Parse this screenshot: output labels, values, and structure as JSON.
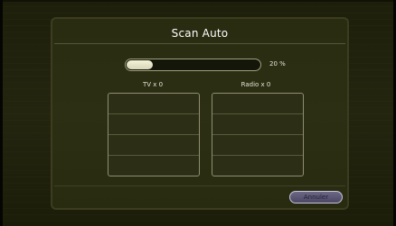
{
  "dialog": {
    "title": "Scan Auto"
  },
  "progress": {
    "value_percent": 20,
    "label": "20 %"
  },
  "lists": {
    "tv": {
      "label": "TV x  0",
      "count": 0
    },
    "radio": {
      "label": "Radio x  0",
      "count": 0
    }
  },
  "footer": {
    "cancel_label": "Annuler"
  },
  "colors": {
    "background": "#23250f",
    "dialog_border": "#3c3d1f",
    "progress_fill": "#f5f3d8",
    "cancel_button": "#5a5674"
  }
}
